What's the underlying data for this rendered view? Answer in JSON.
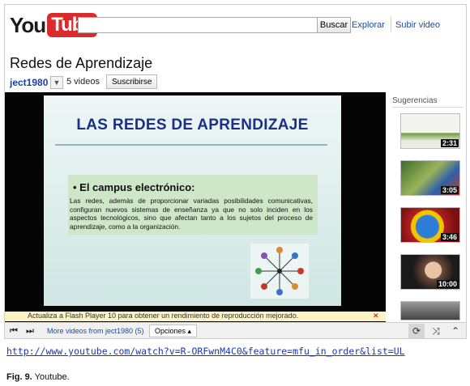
{
  "header": {
    "logo_you": "You",
    "logo_tube": "Tube",
    "search_button": "Buscar",
    "explore": "Explorar",
    "upload": "Subir video"
  },
  "video": {
    "title": "Redes de Aprendizaje",
    "channel": "ject1980",
    "video_count": "5 videos",
    "subscribe": "Suscribirse"
  },
  "slide": {
    "title": "LAS REDES DE APRENDIZAJE",
    "subtitle": "• El campus electrónico:",
    "body": "Las redes, además de proporcionar variadas posibilidades comunicativas, configuran nuevos sistemas de enseñanza ya que no solo inciden en los aspectos tecnológicos, sino que afectan tanto a los sujetos del proceso de aprendizaje, como a la organización."
  },
  "flash_notice": "Actualiza a Flash Player 10 para obtener un rendimiento de reproducción mejorado.",
  "sidebar": {
    "label": "Sugerencias",
    "thumbs": [
      {
        "duration": "2:31"
      },
      {
        "duration": "3:05"
      },
      {
        "duration": "3:46"
      },
      {
        "duration": "10:00"
      },
      {
        "duration": ""
      }
    ]
  },
  "controls": {
    "more_videos": "More videos from ject1980 (5)",
    "options": "Opciones ▴"
  },
  "page": {
    "url": "http://www.youtube.com/watch?v=R-ORFwnM4C0&feature=mfu_in_order&list=UL",
    "caption_label": "Fig. 9.",
    "caption_text": "Youtube."
  }
}
